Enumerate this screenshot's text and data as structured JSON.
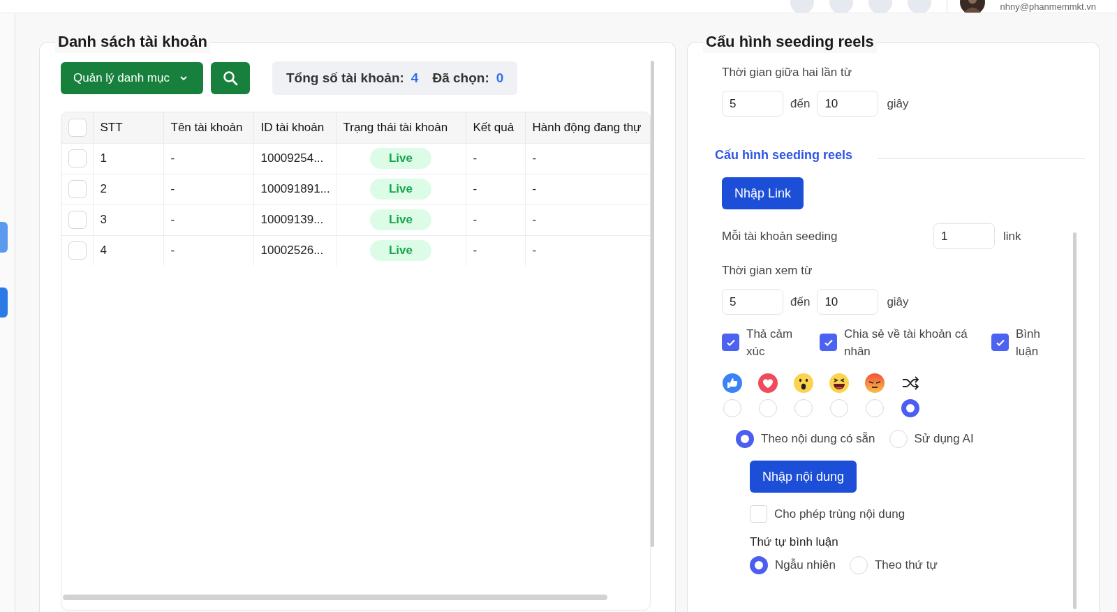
{
  "header": {
    "user_email": "nhny@phanmemmkt.vn"
  },
  "accounts_panel": {
    "title": "Danh sách tài khoản",
    "manage_button": "Quản lý danh mục",
    "stats": {
      "total_label": "Tổng số tài khoản:",
      "total": "4",
      "selected_label": "Đã chọn:",
      "selected": "0"
    },
    "table": {
      "select_all": false,
      "columns": [
        "STT",
        "Tên tài khoản",
        "ID tài khoản",
        "Trạng thái tài khoản",
        "Kết quả",
        "Hành động đang thự"
      ],
      "rows": [
        {
          "selected": false,
          "stt": "1",
          "name": "-",
          "id": "10009254...",
          "status": "Live",
          "result": "-",
          "action": "-"
        },
        {
          "selected": false,
          "stt": "2",
          "name": "-",
          "id": "100091891...",
          "status": "Live",
          "result": "-",
          "action": "-"
        },
        {
          "selected": false,
          "stt": "3",
          "name": "-",
          "id": "10009139...",
          "status": "Live",
          "result": "-",
          "action": "-"
        },
        {
          "selected": false,
          "stt": "4",
          "name": "-",
          "id": "10002526...",
          "status": "Live",
          "result": "-",
          "action": "-"
        }
      ]
    }
  },
  "config_panel": {
    "title": "Cấu hình seeding reels",
    "interval": {
      "label": "Thời gian giữa hai lần từ",
      "from": "5",
      "to_label": "đến",
      "to": "10",
      "unit": "giây"
    },
    "section_title": "Cấu hình seeding reels",
    "import_link_button": "Nhập Link",
    "per_account": {
      "label": "Mỗi tài khoản seeding",
      "value": "1",
      "unit": "link"
    },
    "watch": {
      "label": "Thời gian xem từ",
      "from": "5",
      "to_label": "đến",
      "to": "10",
      "unit": "giây"
    },
    "actions": [
      {
        "label": "Thả cảm xúc",
        "checked": true
      },
      {
        "label": "Chia sẻ về tài khoản cá nhân",
        "checked": true
      },
      {
        "label": "Bình luận",
        "checked": true
      }
    ],
    "reactions": [
      {
        "kind": "like",
        "selected": false
      },
      {
        "kind": "love",
        "selected": false
      },
      {
        "kind": "wow",
        "selected": false
      },
      {
        "kind": "haha",
        "selected": false
      },
      {
        "kind": "angry",
        "selected": false
      },
      {
        "kind": "random",
        "selected": true
      }
    ],
    "content_modes": [
      {
        "label": "Theo nội dung có sẵn",
        "selected": true
      },
      {
        "label": "Sử dụng AI",
        "selected": false
      }
    ],
    "import_content_button": "Nhập nội dung",
    "allow_duplicate": {
      "label": "Cho phép trùng nội dung",
      "checked": false
    },
    "order": {
      "title": "Thứ tự bình luận",
      "options": [
        {
          "label": "Ngẫu nhiên",
          "selected": true
        },
        {
          "label": "Theo thứ tự",
          "selected": false
        }
      ]
    }
  }
}
